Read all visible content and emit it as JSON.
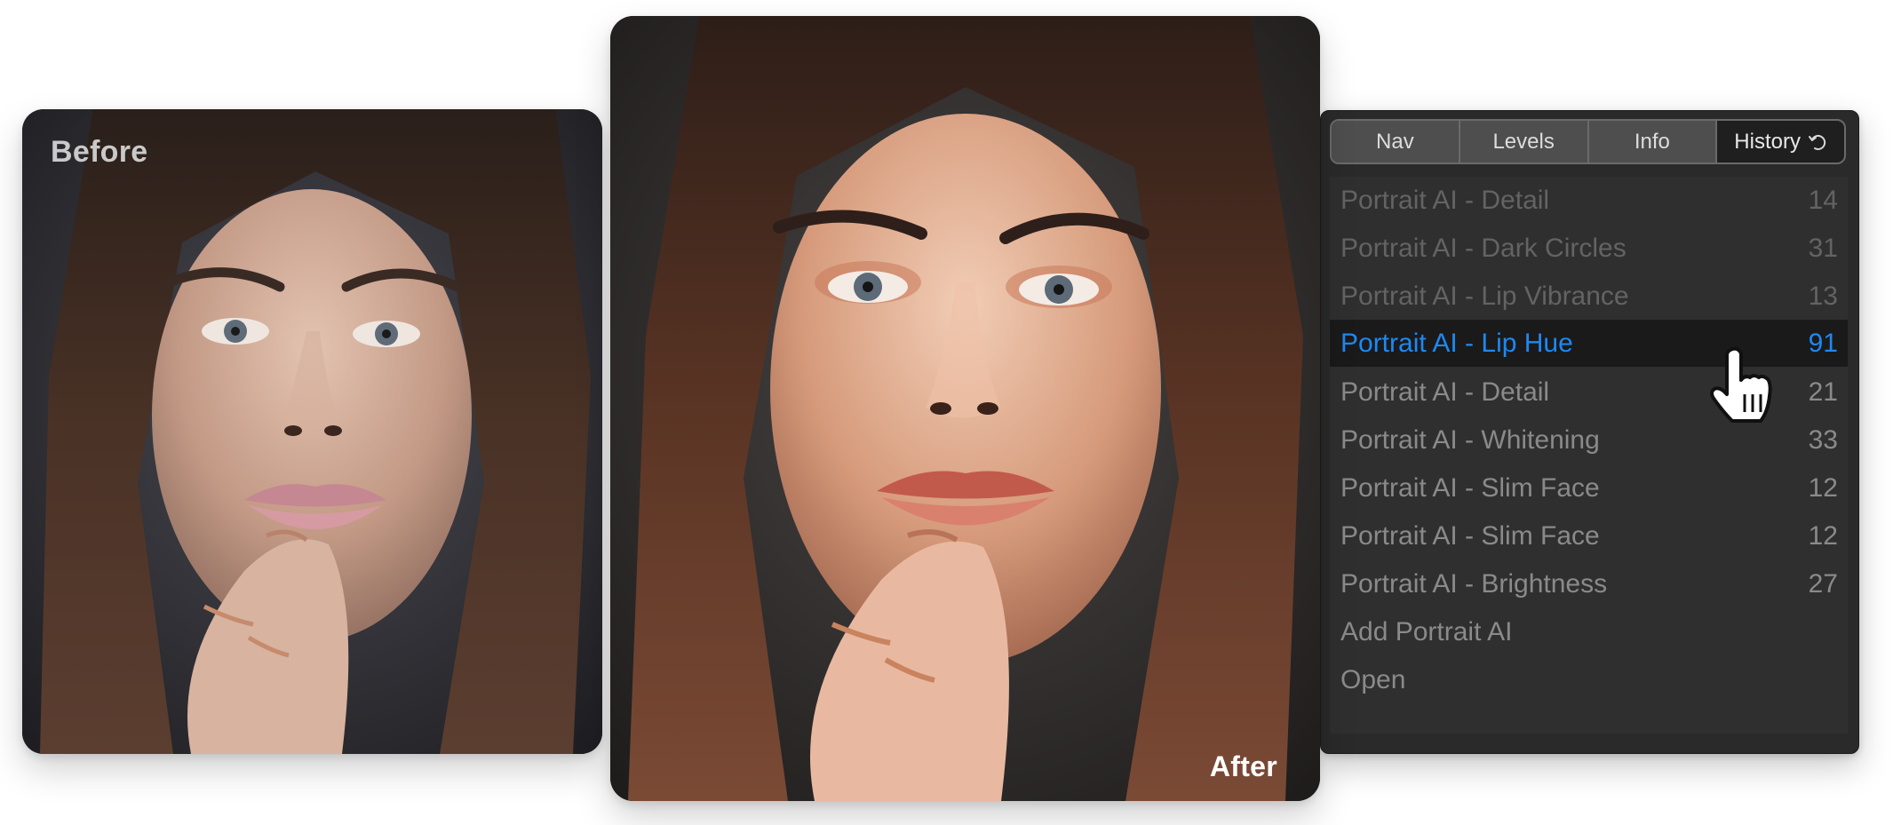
{
  "before_photo": {
    "label": "Before",
    "description": "Portrait photo, unedited: woman with long brown hair, finger with rings at chin, grey backdrop",
    "colors": {
      "background": "#2b2b30",
      "skin": "#c49a86",
      "lips": "#c98a94",
      "hair": "#3a2a22"
    }
  },
  "after_photo": {
    "label": "After",
    "description": "Portrait photo, retouched with Portrait AI: warmer skin tones, redder lips",
    "colors": {
      "background": "#2a2626",
      "skin": "#d79c7e",
      "lips": "#c8675a",
      "hair": "#3f2a20"
    }
  },
  "panel": {
    "tabs": [
      {
        "label": "Nav",
        "active": false
      },
      {
        "label": "Levels",
        "active": false
      },
      {
        "label": "Info",
        "active": false
      },
      {
        "label": "History",
        "active": true,
        "icon": "undo-history-icon"
      }
    ],
    "history": [
      {
        "label": "Portrait AI - Detail",
        "value": "14",
        "state": "dim"
      },
      {
        "label": "Portrait AI - Dark Circles",
        "value": "31",
        "state": "dim"
      },
      {
        "label": "Portrait AI - Lip Vibrance",
        "value": "13",
        "state": "dim"
      },
      {
        "label": "Portrait AI - Lip Hue",
        "value": "91",
        "state": "selected"
      },
      {
        "label": "Portrait AI - Detail",
        "value": "21",
        "state": "normal"
      },
      {
        "label": "Portrait AI - Whitening",
        "value": "33",
        "state": "normal"
      },
      {
        "label": "Portrait AI - Slim Face",
        "value": "12",
        "state": "normal"
      },
      {
        "label": "Portrait AI - Slim Face",
        "value": "12",
        "state": "normal"
      },
      {
        "label": "Portrait AI - Brightness",
        "value": "27",
        "state": "normal"
      },
      {
        "label": "Add Portrait AI",
        "value": "",
        "state": "normal"
      },
      {
        "label": "Open",
        "value": "",
        "state": "normal"
      }
    ],
    "selected_color": "#1e88f2"
  },
  "cursor": {
    "icon": "pointing-hand-cursor-icon"
  }
}
